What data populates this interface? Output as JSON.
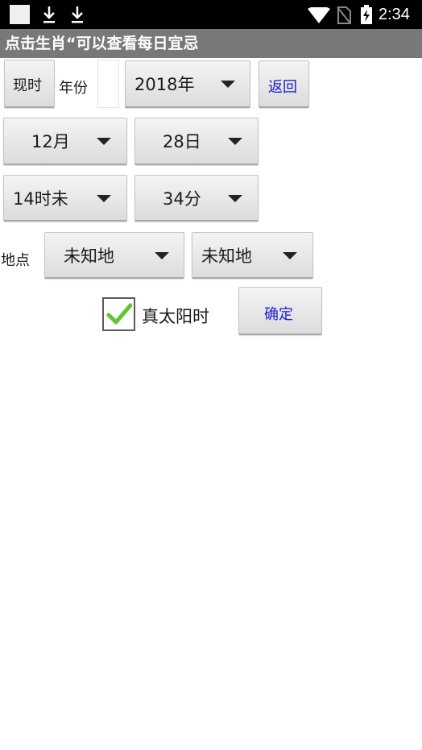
{
  "status_bar": {
    "time": "2:34",
    "icons": [
      "notification-square-icon",
      "download-icon",
      "download-icon",
      "wifi-icon",
      "no-sim-icon",
      "battery-charging-icon"
    ]
  },
  "title_bar": {
    "text": "点击生肖“可以查看每日宜忌"
  },
  "row1": {
    "now_button": "现时",
    "year_label": "年份",
    "year_input_value": "",
    "year_spinner": "2018年",
    "back_button": "返回"
  },
  "row2": {
    "month_spinner": "12月",
    "day_spinner": "28日"
  },
  "row3": {
    "hour_spinner": "14时未",
    "minute_spinner": "34分"
  },
  "row4": {
    "location_label": "地点",
    "province_spinner": "未知地",
    "city_spinner": "未知地"
  },
  "row5": {
    "true_solar_time_label": "真太阳时",
    "true_solar_time_checked": true,
    "confirm_button": "确定"
  },
  "colors": {
    "title_bar": "#787878",
    "link_text": "#1a1ad0",
    "check_green": "#5fc82e"
  }
}
